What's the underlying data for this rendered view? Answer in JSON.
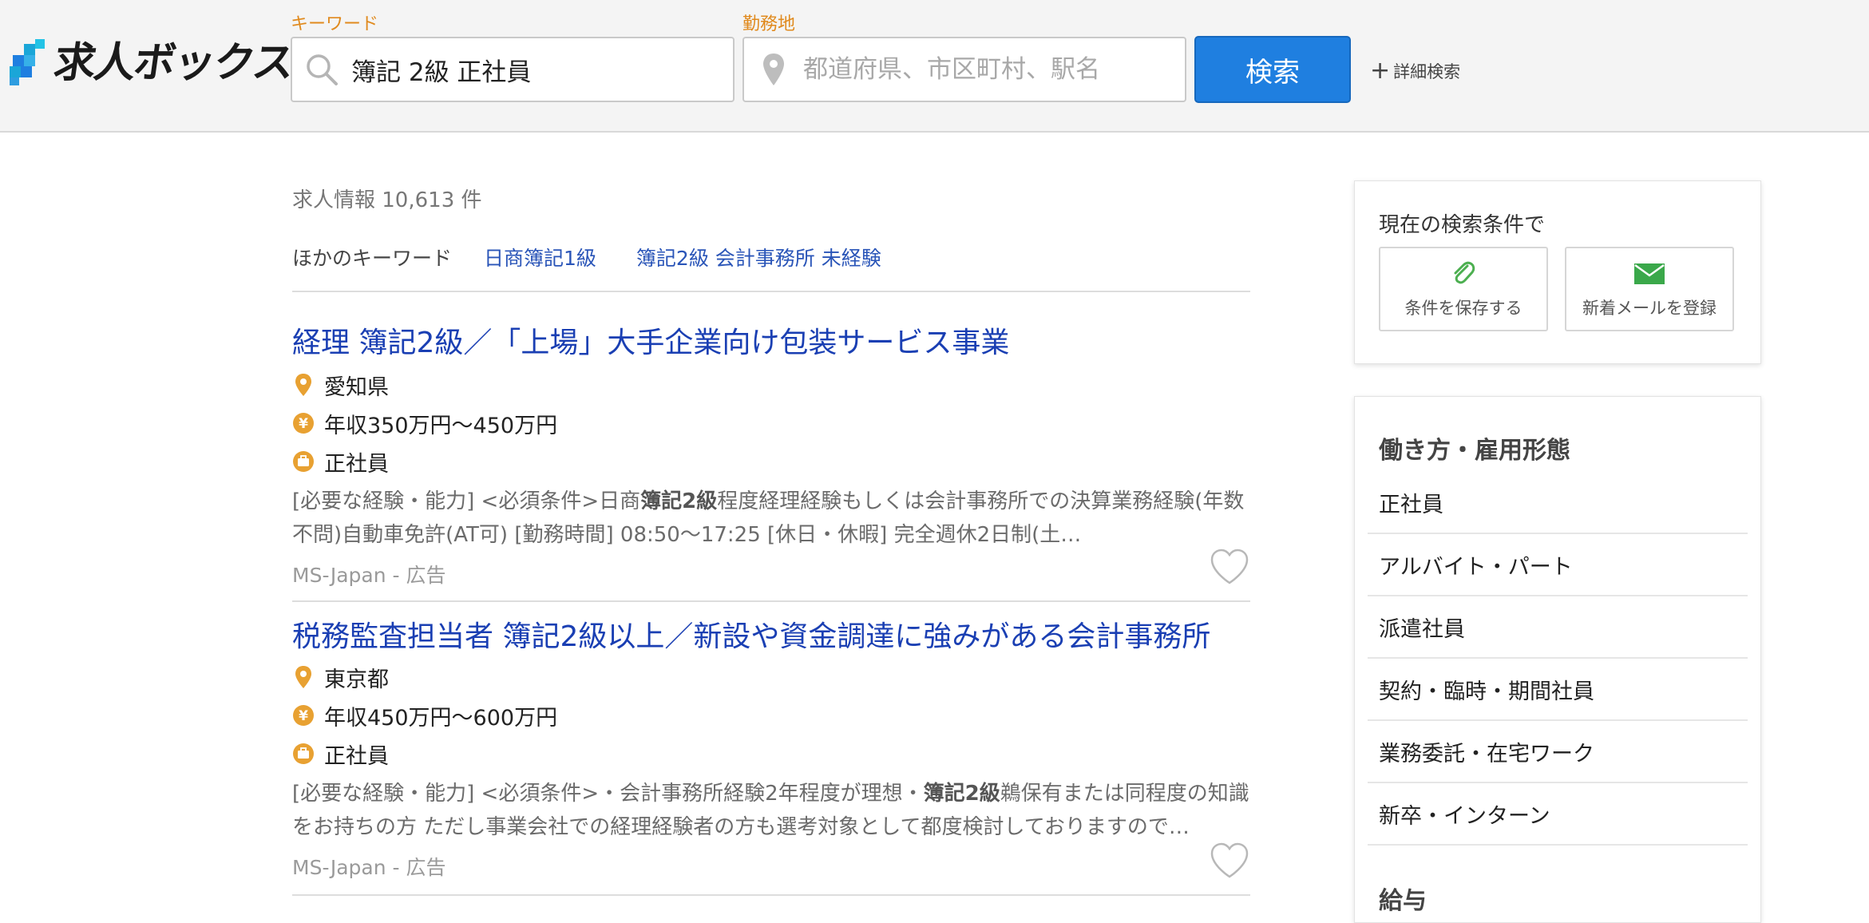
{
  "header": {
    "logo_text": "求人ボックス",
    "keyword_label": "キーワード",
    "keyword_value": "簿記 2級 正社員",
    "location_label": "勤務地",
    "location_placeholder": "都道府県、市区町村、駅名",
    "search_button": "検索",
    "advanced_search": "詳細検索",
    "accent_color": "#1f7fe0",
    "label_color": "#e08a1e"
  },
  "results": {
    "count_text": "求人情報 10,613 件",
    "other_keywords_label": "ほかのキーワード",
    "other_keywords": [
      "日商簿記1級",
      "簿記2級 会計事務所 未経験"
    ]
  },
  "jobs": [
    {
      "title": "経理 簿記2級／「上場」大手企業向け包装サービス事業",
      "location": "愛知県",
      "salary": "年収350万円～450万円",
      "employment": "正社員",
      "desc_before": "[必要な経験・能力] <必須条件>日商",
      "desc_bold": "簿記2級",
      "desc_after": "程度経理経験もしくは会計事務所での決算業務経験(年数不問)自動車免許(AT可) [勤務時間] 08:50～17:25 [休日・休暇] 完全週休2日制(土…",
      "source": "MS-Japan - 広告"
    },
    {
      "title": "税務監査担当者 簿記2級以上／新設や資金調達に強みがある会計事務所",
      "location": "東京都",
      "salary": "年収450万円～600万円",
      "employment": "正社員",
      "desc_before": "[必要な経験・能力] <必須条件>・会計事務所経験2年程度が理想・",
      "desc_bold": "簿記2級",
      "desc_after": "鵜保有または同程度の知識をお持ちの方 ただし事業会社での経理経験者の方も選考対象として都度検討しておりますので…",
      "source": "MS-Japan - 広告"
    }
  ],
  "sidebar": {
    "save_title": "現在の検索条件で",
    "save_condition": "条件を保存する",
    "new_mail": "新着メールを登録",
    "employment_heading": "働き方・雇用形態",
    "employment_types": [
      "正社員",
      "アルバイト・パート",
      "派遣社員",
      "契約・臨時・期間社員",
      "業務委託・在宅ワーク",
      "新卒・インターン"
    ],
    "salary_heading": "給与"
  },
  "icons": [
    "search-icon",
    "location-pin-icon",
    "yen-icon",
    "briefcase-icon",
    "heart-icon",
    "paperclip-icon",
    "mail-icon"
  ]
}
